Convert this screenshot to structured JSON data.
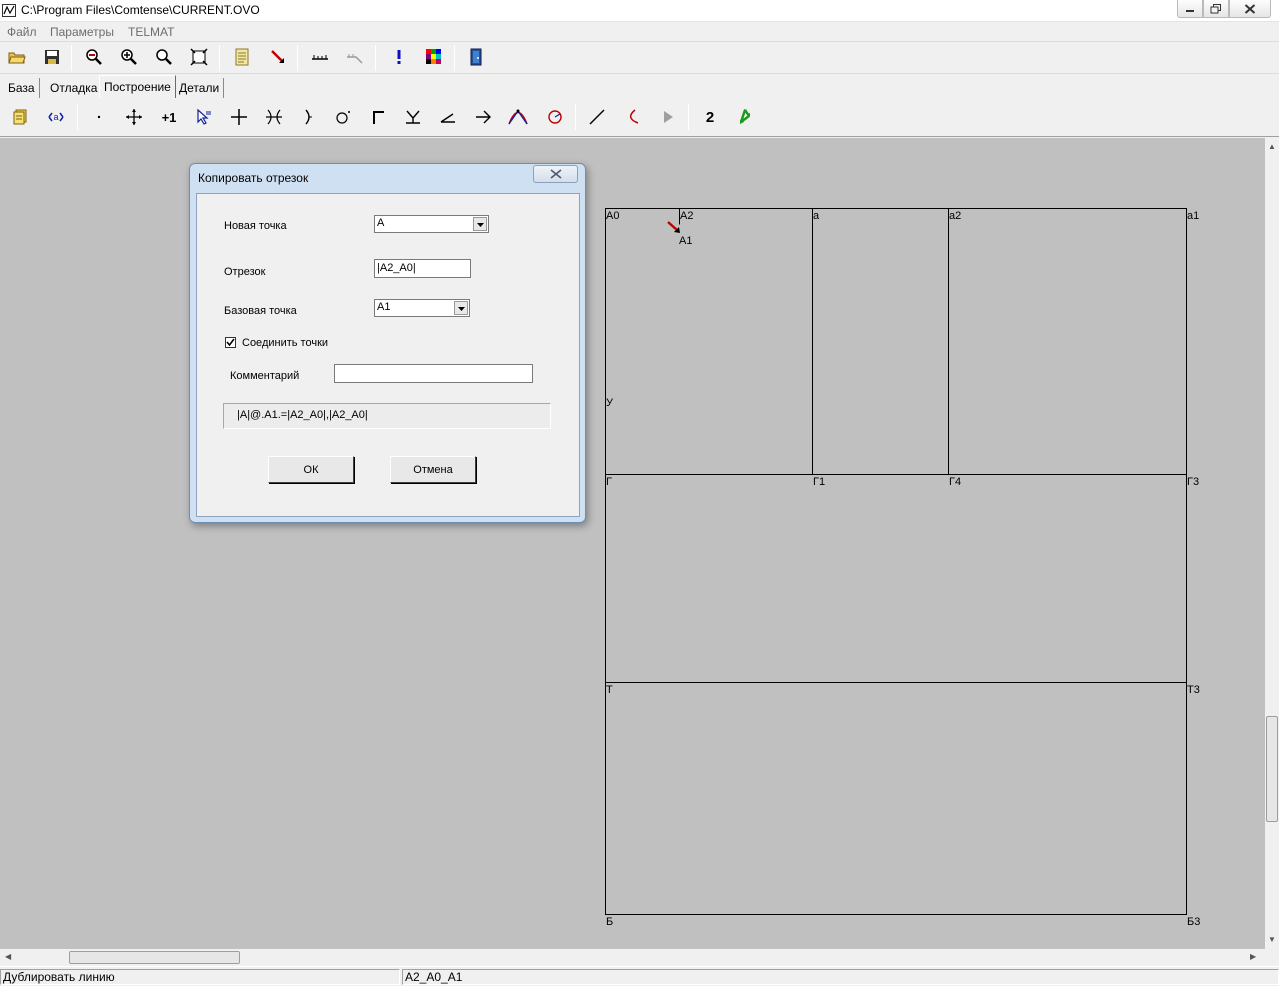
{
  "window": {
    "title": "C:\\Program Files\\Comtense\\CURRENT.OVO"
  },
  "menu": {
    "items": [
      "Файл",
      "Параметры",
      "TELMAT"
    ]
  },
  "tabs": [
    "База",
    "Отладка",
    "Построение",
    "Детали"
  ],
  "active_tab": "Построение",
  "toolbar2": {
    "number_label": "2"
  },
  "drawing": {
    "points": {
      "A0": "А0",
      "A2": "А2",
      "A1": "А1",
      "a": "а",
      "a2": "а2",
      "a1": "а1",
      "U": "У",
      "G": "Г",
      "G1": "Г1",
      "G4": "Г4",
      "G3": "Г3",
      "T": "Т",
      "T3": "Т3",
      "B": "Б",
      "B3": "Б3"
    }
  },
  "dialog": {
    "title": "Копировать отрезок",
    "new_point_label": "Новая точка",
    "new_point_value": "А",
    "segment_label": "Отрезок",
    "segment_value": "|А2_А0|",
    "base_point_label": "Базовая точка",
    "base_point_value": "А1",
    "connect_label": "Соединить точки",
    "connect_checked": true,
    "comment_label": "Комментарий",
    "comment_value": "",
    "formula": "|А|@.А1.=|А2_А0|,|А2_А0|",
    "ok_label": "ОК",
    "cancel_label": "Отмена"
  },
  "status": {
    "left": "Дублировать линию",
    "right": "А2_А0_А1"
  },
  "colors": {
    "canvas": "#c0c0c0",
    "dialog_frame": "#cfe0f3"
  }
}
